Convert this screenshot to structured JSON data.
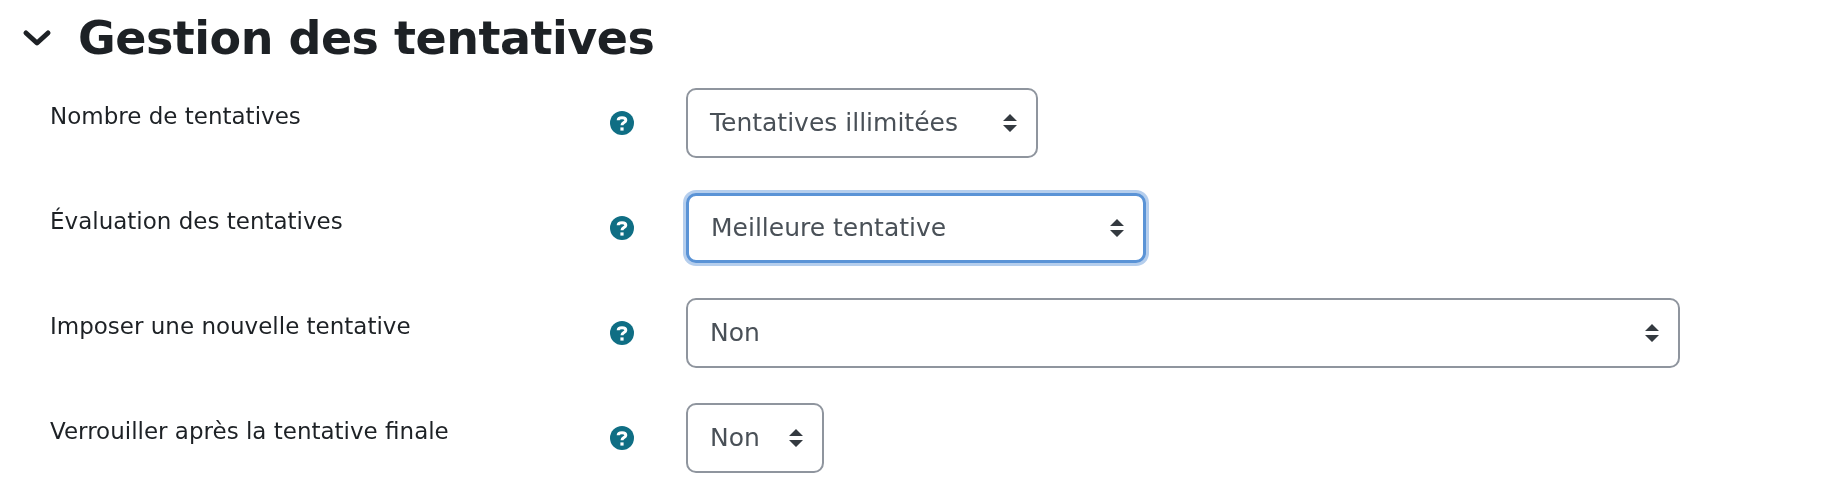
{
  "section": {
    "title": "Gestion des tentatives",
    "expanded": true
  },
  "fields": [
    {
      "label": "Nombre de tentatives",
      "value": "Tentatives illimitées",
      "focused": false
    },
    {
      "label": "Évaluation des tentatives",
      "value": "Meilleure tentative",
      "focused": true
    },
    {
      "label": "Imposer une nouvelle tentative",
      "value": "Non",
      "focused": false
    },
    {
      "label": "Verrouiller après la tentative finale",
      "value": "Non",
      "focused": false
    }
  ]
}
